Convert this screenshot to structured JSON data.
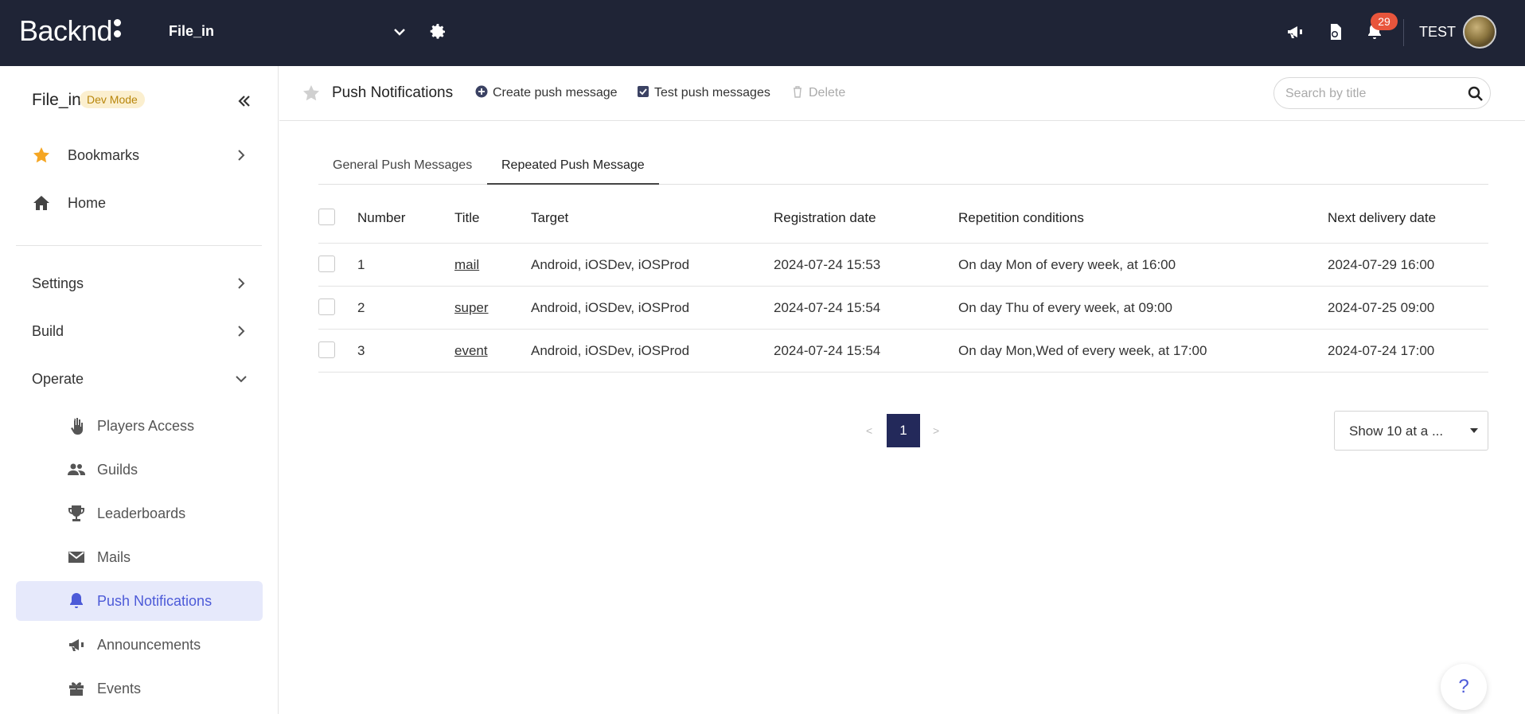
{
  "app": {
    "logo_text": "Backnd",
    "project_name": "File_in",
    "notification_count": "29",
    "user_name": "TEST"
  },
  "sidebar": {
    "project_name": "File_in",
    "mode_badge": "Dev Mode",
    "top_items": [
      {
        "label": "Bookmarks",
        "icon": "star-icon"
      },
      {
        "label": "Home",
        "icon": "home-icon"
      }
    ],
    "sections": [
      {
        "label": "Settings",
        "expanded": false
      },
      {
        "label": "Build",
        "expanded": false
      },
      {
        "label": "Operate",
        "expanded": true
      }
    ],
    "operate_items": [
      {
        "label": "Players Access",
        "icon": "hand-icon"
      },
      {
        "label": "Guilds",
        "icon": "users-icon"
      },
      {
        "label": "Leaderboards",
        "icon": "trophy-icon"
      },
      {
        "label": "Mails",
        "icon": "envelope-icon"
      },
      {
        "label": "Push Notifications",
        "icon": "bell-icon",
        "active": true
      },
      {
        "label": "Announcements",
        "icon": "megaphone-icon"
      },
      {
        "label": "Events",
        "icon": "gift-icon"
      }
    ]
  },
  "header": {
    "title": "Push Notifications",
    "create_label": "Create push message",
    "test_label": "Test push messages",
    "delete_label": "Delete",
    "search_placeholder": "Search by title"
  },
  "tabs": [
    {
      "label": "General Push Messages",
      "active": false
    },
    {
      "label": "Repeated Push Message",
      "active": true
    }
  ],
  "table": {
    "columns": [
      "Number",
      "Title",
      "Target",
      "Registration date",
      "Repetition conditions",
      "Next delivery date"
    ],
    "rows": [
      {
        "number": "1",
        "title": "mail",
        "target": "Android, iOSDev, iOSProd",
        "registration": "2024-07-24 15:53",
        "conditions": "On day Mon of every week, at 16:00",
        "next": "2024-07-29 16:00"
      },
      {
        "number": "2",
        "title": "super",
        "target": "Android, iOSDev, iOSProd",
        "registration": "2024-07-24 15:54",
        "conditions": "On day Thu of every week, at 09:00",
        "next": "2024-07-25 09:00"
      },
      {
        "number": "3",
        "title": "event",
        "target": "Android, iOSDev, iOSProd",
        "registration": "2024-07-24 15:54",
        "conditions": "On day Mon,Wed of every week, at 17:00",
        "next": "2024-07-24 17:00"
      }
    ]
  },
  "pagination": {
    "prev": "<",
    "current": "1",
    "next": ">",
    "page_size": "Show 10 at a ..."
  },
  "help": "?",
  "colors": {
    "topbar": "#1f2436",
    "accent": "#4c5ad8",
    "badge": "#e8553c",
    "dev_badge_bg": "#fbefcf",
    "dev_badge_text": "#b8860b",
    "bookmark_star": "#f5a623",
    "active_page": "#23295a"
  }
}
